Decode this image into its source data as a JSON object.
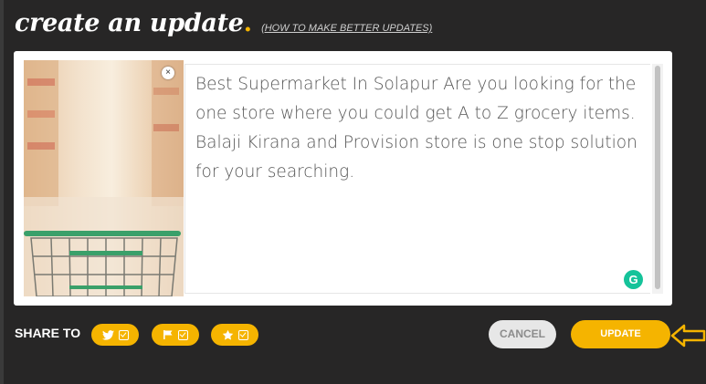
{
  "header": {
    "title": "create an update",
    "dot": ".",
    "howto_link": "(HOW TO MAKE BETTER UPDATES)"
  },
  "editor": {
    "text": "Best Supermarket In Solapur Are you looking for the one store where you could get A to Z grocery items. Balaji Kirana and Provision store is one stop solution for your searching.",
    "remove_image_glyph": "×",
    "grammarly_glyph": "G",
    "image_icon": "shopping-cart-photo"
  },
  "share": {
    "label": "SHARE TO",
    "targets": [
      {
        "icon": "twitter-icon",
        "checked": true
      },
      {
        "icon": "flag-icon",
        "checked": true
      },
      {
        "icon": "star-icon",
        "checked": true
      }
    ]
  },
  "actions": {
    "cancel_label": "CANCEL",
    "update_label": "UPDATE"
  },
  "colors": {
    "background": "#272626",
    "accent": "#f5b400",
    "grammarly": "#15c39a",
    "cancel_bg": "#e7e7e7"
  }
}
